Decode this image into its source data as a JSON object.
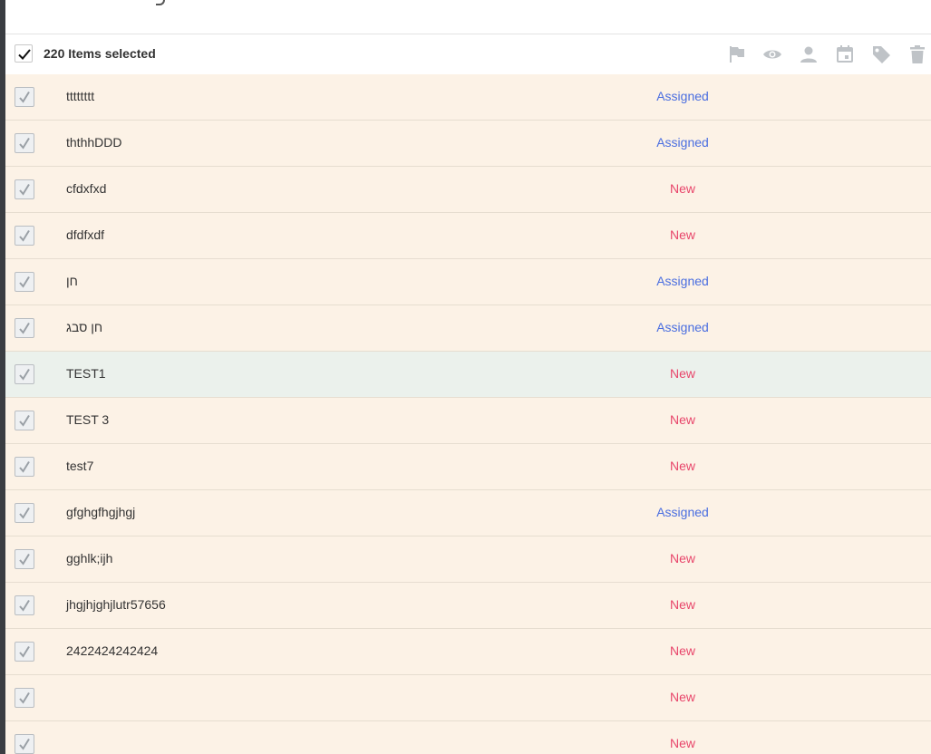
{
  "selection": {
    "label": "220 Items selected"
  },
  "toolbar": {
    "icons": [
      "flag-icon",
      "eye-icon",
      "person-icon",
      "calendar-icon",
      "tag-icon",
      "trash-icon"
    ]
  },
  "colors": {
    "row_bg": "#fcf2e6",
    "row_hover_bg": "#ebf1ec",
    "assigned": "#4a6ee0",
    "new": "#e8456a"
  },
  "rows": [
    {
      "name": "tttttttt",
      "status": "Assigned",
      "status_type": "assigned",
      "checked": true
    },
    {
      "name": "ththhDDD",
      "status": "Assigned",
      "status_type": "assigned",
      "checked": true
    },
    {
      "name": "cfdxfxd",
      "status": "New",
      "status_type": "new",
      "checked": true
    },
    {
      "name": "dfdfxdf",
      "status": "New",
      "status_type": "new",
      "checked": true
    },
    {
      "name": "חן",
      "status": "Assigned",
      "status_type": "assigned",
      "checked": true
    },
    {
      "name": "חן סבג",
      "status": "Assigned",
      "status_type": "assigned",
      "checked": true
    },
    {
      "name": "TEST1",
      "status": "New",
      "status_type": "new",
      "checked": true,
      "hover": true
    },
    {
      "name": "TEST 3",
      "status": "New",
      "status_type": "new",
      "checked": true
    },
    {
      "name": "test7",
      "status": "New",
      "status_type": "new",
      "checked": true
    },
    {
      "name": "gfghgfhgjhgj",
      "status": "Assigned",
      "status_type": "assigned",
      "checked": true
    },
    {
      "name": "gghlk;ijh",
      "status": "New",
      "status_type": "new",
      "checked": true
    },
    {
      "name": "jhgjhjghjlutr57656",
      "status": "New",
      "status_type": "new",
      "checked": true
    },
    {
      "name": "2422424242424",
      "status": "New",
      "status_type": "new",
      "checked": true
    },
    {
      "name": "",
      "status": "New",
      "status_type": "new",
      "checked": true
    },
    {
      "name": "",
      "status": "New",
      "status_type": "new",
      "checked": true
    }
  ]
}
